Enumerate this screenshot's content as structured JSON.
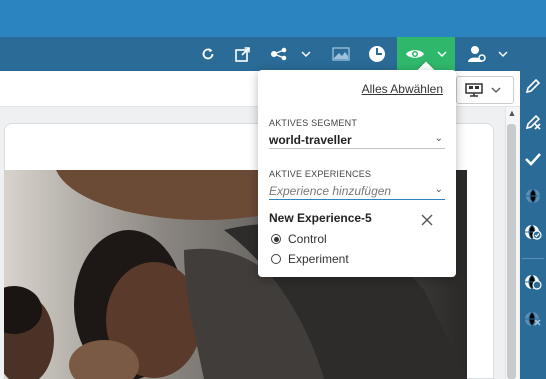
{
  "colors": {
    "header_blue": "#2b84c0",
    "toolbar_blue": "#2a6b97",
    "preview_green": "#2fb86b"
  },
  "toolbar": {
    "icons": [
      "refresh-icon",
      "external-link-icon",
      "share-icon",
      "chevron-down-icon",
      "image-icon",
      "history-icon",
      "eye-icon",
      "chevron-down-icon",
      "user-settings-icon",
      "chevron-down-icon"
    ]
  },
  "popover": {
    "deselect_all_label": "Alles Abwählen",
    "segment_label": "AKTIVES SEGMENT",
    "segment_value": "world-traveller",
    "experiences_label": "AKTIVE EXPERIENCES",
    "experience_placeholder": "Experience hinzufügen",
    "experience_title": "New Experience-5",
    "variants": [
      {
        "label": "Control",
        "selected": true
      },
      {
        "label": "Experiment",
        "selected": false
      }
    ]
  },
  "right_sidebar": {
    "icons": [
      "edit-pencil-icon",
      "edit-clear-icon",
      "check-icon",
      "globe-icon",
      "globe-check-icon",
      "globe-refresh-icon",
      "globe-remove-icon"
    ]
  }
}
